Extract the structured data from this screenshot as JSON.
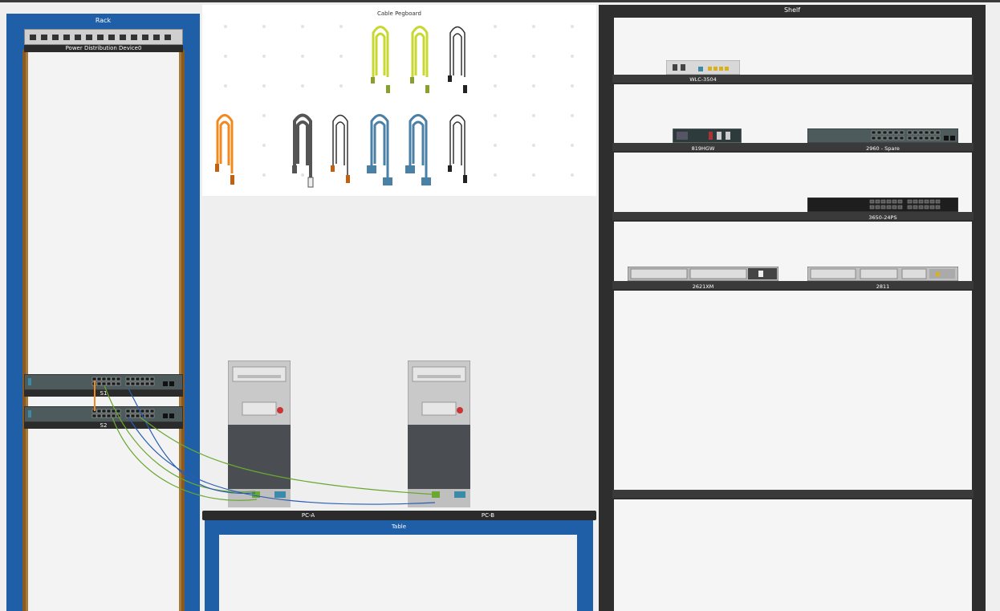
{
  "rack": {
    "title": "Rack",
    "pdu_label": "Power Distribution Device0",
    "switch1_label": "S1",
    "switch2_label": "S2"
  },
  "pegboard": {
    "title": "Cable Pegboard"
  },
  "shelf": {
    "title": "Shelf",
    "devices": {
      "wlc": "WLC-3504",
      "r819": "819HGW",
      "sw2960": "2960 - Spare",
      "sw3650": "3650-24PS",
      "r2621": "2621XM",
      "r2811": "2811"
    }
  },
  "table": {
    "title": "Table",
    "pc_a": "PC-A",
    "pc_b": "PC-B"
  },
  "colors": {
    "rack_blue": "#1f5fa8",
    "shelf_dark": "#2e2e2e",
    "cable_green": "#6aa832",
    "cable_blue": "#2a5db0",
    "cable_yellow": "#c8d832",
    "cable_orange": "#f08a1e",
    "cable_steel": "#4a7fa6"
  }
}
